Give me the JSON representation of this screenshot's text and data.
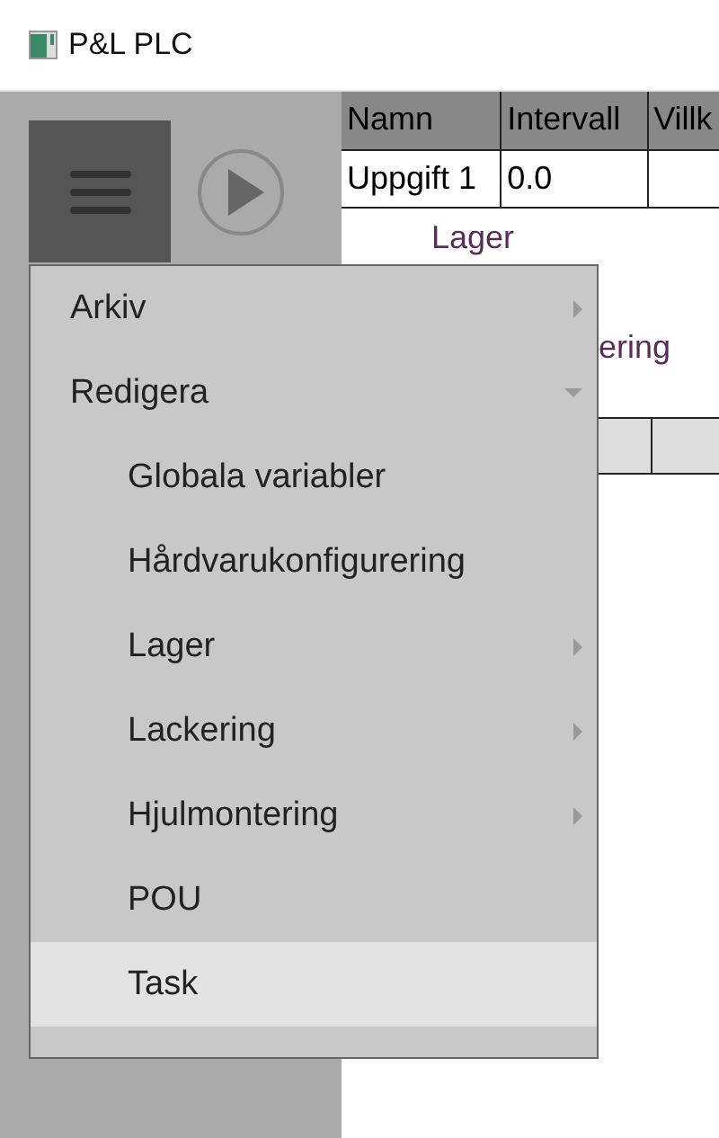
{
  "window": {
    "title": "P&L PLC"
  },
  "table": {
    "columns": [
      "Namn",
      "Intervall",
      "Villk"
    ],
    "rows": [
      [
        "Uppgift 1",
        "0.0",
        ""
      ]
    ]
  },
  "labels": [
    "Lager",
    "ering"
  ],
  "menu": {
    "items": [
      {
        "label": "Arkiv",
        "kind": "folder",
        "expanded": false,
        "selected": false
      },
      {
        "label": "Redigera",
        "kind": "folder",
        "expanded": true,
        "selected": false,
        "children": [
          {
            "label": "Globala variabler",
            "kind": "leaf",
            "selected": false
          },
          {
            "label": "Hårdvarukonfigurering",
            "kind": "leaf",
            "selected": false
          },
          {
            "label": "Lager",
            "kind": "folder",
            "expanded": false,
            "selected": false
          },
          {
            "label": "Lackering",
            "kind": "folder",
            "expanded": false,
            "selected": false
          },
          {
            "label": "Hjulmontering",
            "kind": "folder",
            "expanded": false,
            "selected": false
          },
          {
            "label": "POU",
            "kind": "leaf",
            "selected": false
          },
          {
            "label": "Task",
            "kind": "leaf",
            "selected": true
          }
        ]
      }
    ]
  }
}
